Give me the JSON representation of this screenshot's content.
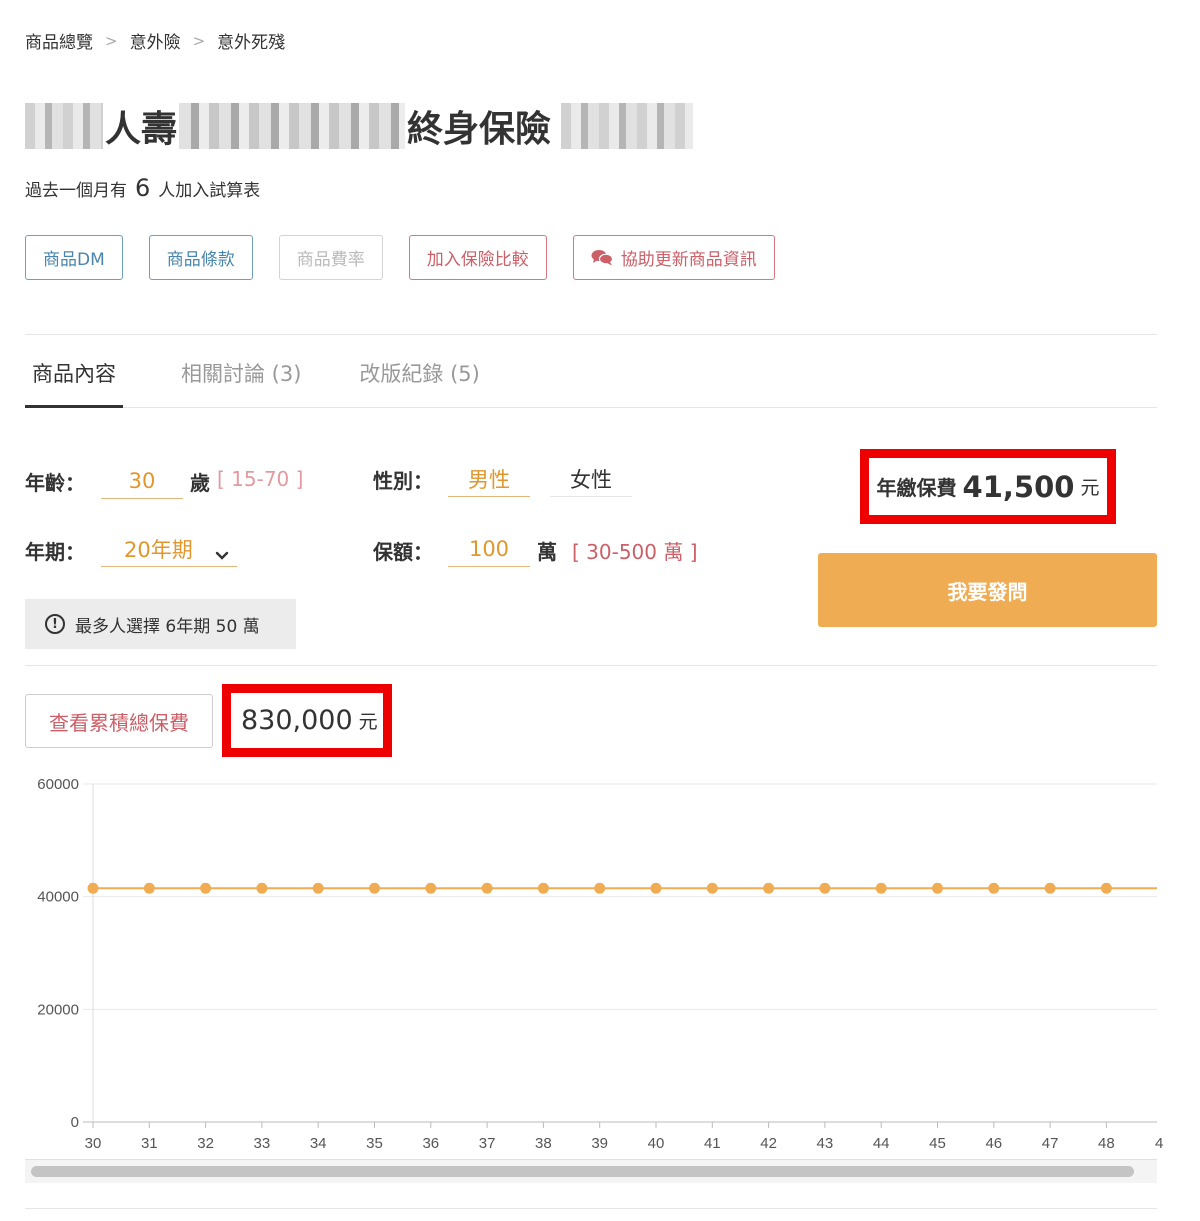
{
  "breadcrumb": {
    "items": [
      "商品總覽",
      "意外險",
      "意外死殘"
    ],
    "separator": ">"
  },
  "product": {
    "title_part1": "人壽",
    "title_part2": "終身保險"
  },
  "popularity": {
    "prefix": "過去一個月有",
    "count": "6",
    "suffix": "人加入試算表"
  },
  "actions": {
    "dm": "商品DM",
    "terms": "商品條款",
    "rates": "商品費率",
    "compare": "加入保險比較",
    "update": "協助更新商品資訊"
  },
  "tabs": [
    {
      "label": "商品內容",
      "active": true
    },
    {
      "label": "相關討論 (3)",
      "active": false
    },
    {
      "label": "改版紀錄 (5)",
      "active": false
    }
  ],
  "form": {
    "age_label": "年齡：",
    "age_value": "30",
    "age_unit": "歲",
    "age_range": "[ 15-70 ]",
    "gender_label": "性別：",
    "gender_male": "男性",
    "gender_female": "女性",
    "gender_selected": "男性",
    "term_label": "年期：",
    "term_value": "20年期",
    "amount_label": "保額：",
    "amount_value": "100",
    "amount_unit": "萬",
    "amount_range": "[ 30-500 萬 ]"
  },
  "tip": {
    "icon": "exclamation-circle-icon",
    "text": "最多人選擇 6年期 50 萬"
  },
  "premium": {
    "label": "年繳保費",
    "value": "41,500",
    "unit": "元"
  },
  "ask_button": "我要發問",
  "cumulative": {
    "button": "查看累積總保費",
    "value": "830,000",
    "unit": "元"
  },
  "colors": {
    "accent": "#f0ac53",
    "highlight": "#ee0000",
    "line": "#f0ac53"
  },
  "chart_data": {
    "type": "line",
    "x": [
      30,
      31,
      32,
      33,
      34,
      35,
      36,
      37,
      38,
      39,
      40,
      41,
      42,
      43,
      44,
      45,
      46,
      47,
      48
    ],
    "series": [
      {
        "values": [
          41500,
          41500,
          41500,
          41500,
          41500,
          41500,
          41500,
          41500,
          41500,
          41500,
          41500,
          41500,
          41500,
          41500,
          41500,
          41500,
          41500,
          41500,
          41500
        ]
      }
    ],
    "yticks": [
      0,
      20000,
      40000,
      60000
    ],
    "ylim": [
      0,
      60000
    ],
    "grid": true
  }
}
